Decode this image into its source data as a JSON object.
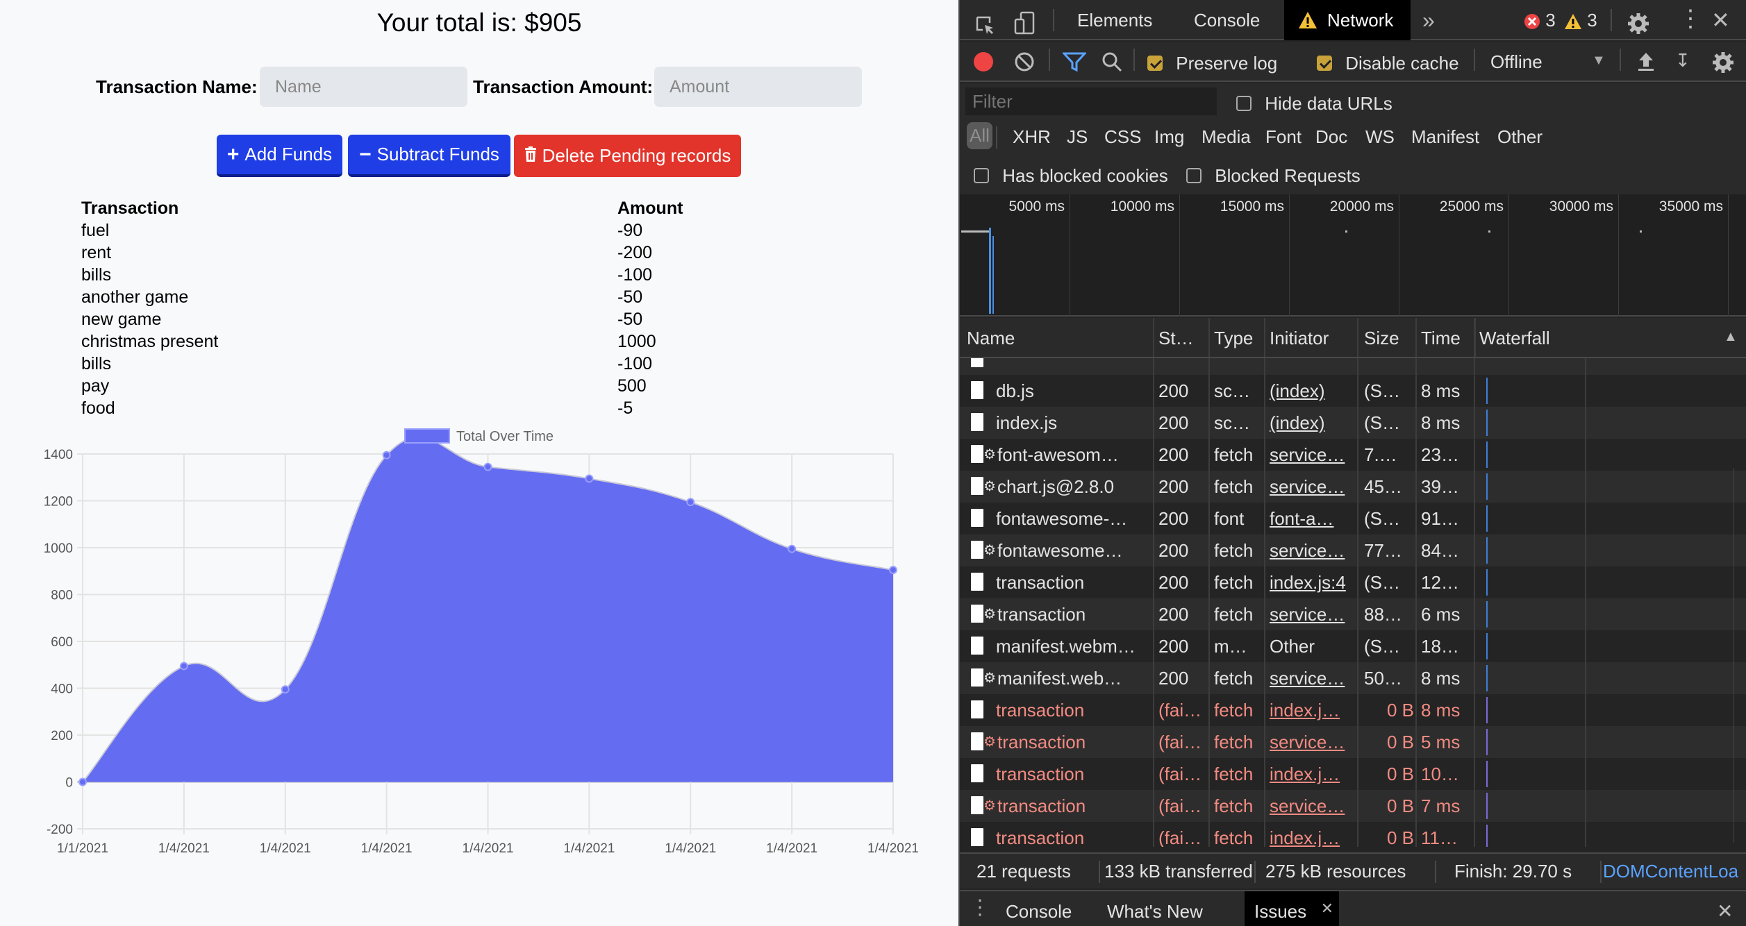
{
  "app": {
    "total_label": "Your total is: $905",
    "name_label": "Transaction Name:",
    "name_placeholder": "Name",
    "amount_label": "Transaction Amount:",
    "amount_placeholder": "Amount",
    "add_label": "Add Funds",
    "subtract_label": "Subtract Funds",
    "delete_label": "Delete Pending records",
    "table": {
      "headers": [
        "Transaction",
        "Amount"
      ],
      "rows": [
        {
          "name": "fuel",
          "amount": "-90"
        },
        {
          "name": "rent",
          "amount": "-200"
        },
        {
          "name": "bills",
          "amount": "-100"
        },
        {
          "name": "another game",
          "amount": "-50"
        },
        {
          "name": "new game",
          "amount": "-50"
        },
        {
          "name": "christmas present",
          "amount": "1000"
        },
        {
          "name": "bills",
          "amount": "-100"
        },
        {
          "name": "pay",
          "amount": "500"
        },
        {
          "name": "food",
          "amount": "-5"
        }
      ]
    }
  },
  "chart_data": {
    "type": "area",
    "legend_label": "Total Over Time",
    "legend_position": "top",
    "categories": [
      "1/1/2021",
      "1/4/2021",
      "1/4/2021",
      "1/4/2021",
      "1/4/2021",
      "1/4/2021",
      "1/4/2021",
      "1/4/2021",
      "1/4/2021"
    ],
    "series": [
      {
        "name": "Total Over Time",
        "values": [
          0,
          495,
          395,
          1395,
          1345,
          1295,
          1195,
          995,
          905
        ],
        "color": "#646cf2"
      }
    ],
    "y_ticks": [
      -200,
      0,
      200,
      400,
      600,
      800,
      1000,
      1200,
      1400
    ],
    "ylim": [
      -200,
      1400
    ],
    "grid": true
  },
  "devtools": {
    "tabs": [
      "Elements",
      "Console",
      "Network"
    ],
    "error_count": "3",
    "warning_count": "3",
    "preserve_log": "Preserve log",
    "disable_cache": "Disable cache",
    "throttle": "Offline",
    "filter_placeholder": "Filter",
    "hide_data_urls": "Hide data URLs",
    "types": [
      "All",
      "XHR",
      "JS",
      "CSS",
      "Img",
      "Media",
      "Font",
      "Doc",
      "WS",
      "Manifest",
      "Other"
    ],
    "has_blocked_cookies": "Has blocked cookies",
    "blocked_requests": "Blocked Requests",
    "timeline_ticks": [
      "5000 ms",
      "10000 ms",
      "15000 ms",
      "20000 ms",
      "25000 ms",
      "30000 ms",
      "35000 ms"
    ],
    "columns": [
      "Name",
      "St…",
      "Type",
      "Initiator",
      "Size",
      "Time",
      "Waterfall"
    ],
    "requests": [
      {
        "name": "db.js",
        "status": "200",
        "type": "sc…",
        "initiator": "(index)",
        "size": "(S…",
        "time": "8 ms",
        "gear": false,
        "fail": false,
        "link": true
      },
      {
        "name": "index.js",
        "status": "200",
        "type": "sc…",
        "initiator": "(index)",
        "size": "(S…",
        "time": "8 ms",
        "gear": false,
        "fail": false,
        "link": true
      },
      {
        "name": "font-awesom…",
        "status": "200",
        "type": "fetch",
        "initiator": "service…",
        "size": "7.…",
        "time": "23…",
        "gear": true,
        "fail": false,
        "link": true
      },
      {
        "name": "chart.js@2.8.0",
        "status": "200",
        "type": "fetch",
        "initiator": "service…",
        "size": "45…",
        "time": "39…",
        "gear": true,
        "fail": false,
        "link": true
      },
      {
        "name": "fontawesome-…",
        "status": "200",
        "type": "font",
        "initiator": "font-a…",
        "size": "(S…",
        "time": "91…",
        "gear": false,
        "fail": false,
        "link": true
      },
      {
        "name": "fontawesome…",
        "status": "200",
        "type": "fetch",
        "initiator": "service…",
        "size": "77…",
        "time": "84…",
        "gear": true,
        "fail": false,
        "link": true
      },
      {
        "name": "transaction",
        "status": "200",
        "type": "fetch",
        "initiator": "index.js:4",
        "size": "(S…",
        "time": "12…",
        "gear": false,
        "fail": false,
        "link": true
      },
      {
        "name": "transaction",
        "status": "200",
        "type": "fetch",
        "initiator": "service…",
        "size": "88…",
        "time": "6 ms",
        "gear": true,
        "fail": false,
        "link": true
      },
      {
        "name": "manifest.webm…",
        "status": "200",
        "type": "m…",
        "initiator": "Other",
        "size": "(S…",
        "time": "18…",
        "gear": false,
        "fail": false,
        "link": false
      },
      {
        "name": "manifest.web…",
        "status": "200",
        "type": "fetch",
        "initiator": "service…",
        "size": "50…",
        "time": "8 ms",
        "gear": true,
        "fail": false,
        "link": true
      },
      {
        "name": "transaction",
        "status": "(fai…",
        "type": "fetch",
        "initiator": "index.j…",
        "size": "0 B",
        "time": "8 ms",
        "gear": false,
        "fail": true,
        "link": true
      },
      {
        "name": "transaction",
        "status": "(fai…",
        "type": "fetch",
        "initiator": "service…",
        "size": "0 B",
        "time": "5 ms",
        "gear": true,
        "fail": true,
        "link": true
      },
      {
        "name": "transaction",
        "status": "(fai…",
        "type": "fetch",
        "initiator": "index.j…",
        "size": "0 B",
        "time": "10…",
        "gear": false,
        "fail": true,
        "link": true
      },
      {
        "name": "transaction",
        "status": "(fai…",
        "type": "fetch",
        "initiator": "service…",
        "size": "0 B",
        "time": "7 ms",
        "gear": true,
        "fail": true,
        "link": true
      },
      {
        "name": "transaction",
        "status": "(fai…",
        "type": "fetch",
        "initiator": "index.j…",
        "size": "0 B",
        "time": "11…",
        "gear": false,
        "fail": true,
        "link": true
      }
    ],
    "status_bar": {
      "requests": "21 requests",
      "transferred": "133 kB transferred",
      "resources": "275 kB resources",
      "finish": "Finish: 29.70 s",
      "dcl": "DOMContentLoa"
    },
    "drawer_tabs": [
      "Console",
      "What's New",
      "Issues"
    ]
  }
}
